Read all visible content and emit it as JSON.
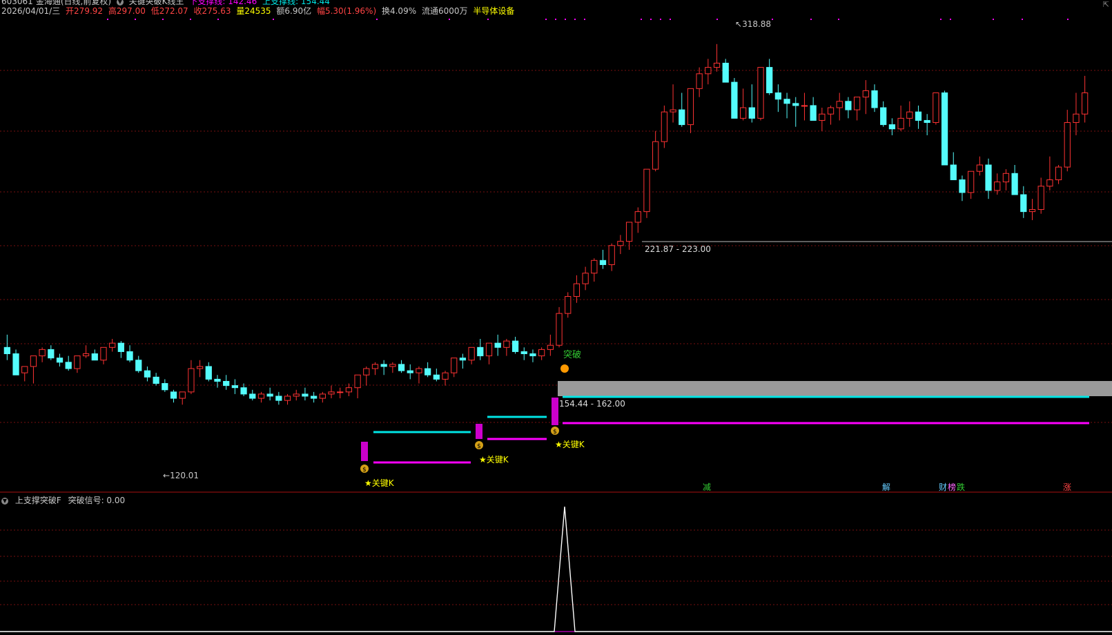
{
  "header": {
    "code": "603061",
    "name": "金海通",
    "period": "(日线,前复权)",
    "indicator_name": "关键突破K线王",
    "lower_support_label": "下支撑线: 142.46",
    "upper_support_label": "上支撑线: 154.44",
    "date": "2026/04/01/三",
    "open": "开279.92",
    "high": "高297.00",
    "low": "低272.07",
    "close": "收275.63",
    "volume": "量24535",
    "amount": "额6.90亿",
    "change": "幅5.30(1.96%)",
    "turnover": "换4.09%",
    "float": "流通6000万",
    "sector": "半导体设备"
  },
  "chart_annotations": {
    "peak_label": "318.88",
    "trough_label": "120.01",
    "upper_zone_label": "221.87 - 223.00",
    "lower_zone_label": "154.44 - 162.00",
    "breakout_label": "突破",
    "key_k_labels": [
      "★关键K",
      "★关键K",
      "★关键K"
    ]
  },
  "event_tags": [
    {
      "label": "减",
      "color": "#33cc33"
    },
    {
      "label": "解",
      "color": "#66ccff"
    },
    {
      "label": "财",
      "color": "#66ccff"
    },
    {
      "label": "榜",
      "color": "#ff66ff"
    },
    {
      "label": "跌",
      "color": "#33cc33"
    },
    {
      "label": "涨",
      "color": "#ff4444"
    }
  ],
  "subchart": {
    "title": "上支撑突破F",
    "signal_label": "突破信号: 0.00"
  },
  "colors": {
    "up": "#ff3333",
    "down": "#54fcfc",
    "grid": "#7a1010",
    "magenta": "#ff00ff",
    "cyan": "#00e5e5",
    "yellow": "#ffff00"
  },
  "chart_data": {
    "type": "candlestick",
    "y_range": [
      112,
      330
    ],
    "candles": [
      [
        176,
        182,
        170,
        173
      ],
      [
        173,
        175,
        163,
        163
      ],
      [
        164,
        166,
        160,
        167
      ],
      [
        167,
        169,
        159,
        172
      ],
      [
        172,
        176,
        169,
        175
      ],
      [
        175,
        177,
        170,
        171
      ],
      [
        171,
        173,
        167,
        169
      ],
      [
        169,
        172,
        165,
        166
      ],
      [
        166,
        170,
        164,
        172
      ],
      [
        172,
        177,
        171,
        173
      ],
      [
        173,
        175,
        170,
        170
      ],
      [
        170,
        175,
        168,
        176
      ],
      [
        176,
        180,
        174,
        178
      ],
      [
        178,
        179,
        171,
        174
      ],
      [
        174,
        177,
        169,
        170
      ],
      [
        170,
        172,
        164,
        165
      ],
      [
        165,
        167,
        160,
        162
      ],
      [
        162,
        164,
        158,
        159
      ],
      [
        159,
        161,
        155,
        156
      ],
      [
        155,
        156,
        150,
        152
      ],
      [
        152,
        154,
        149,
        155
      ],
      [
        155,
        170,
        154,
        166
      ],
      [
        166,
        170,
        162,
        167
      ],
      [
        167,
        169,
        160,
        161
      ],
      [
        161,
        163,
        157,
        160
      ],
      [
        160,
        163,
        156,
        158
      ],
      [
        158,
        161,
        154,
        157
      ],
      [
        157,
        159,
        153,
        154
      ],
      [
        154,
        156,
        151,
        152
      ],
      [
        152,
        155,
        150,
        154
      ],
      [
        154,
        157,
        151,
        153
      ],
      [
        153,
        155,
        149,
        151
      ],
      [
        151,
        154,
        149,
        153
      ],
      [
        153,
        156,
        151,
        154
      ],
      [
        154,
        157,
        151,
        153
      ],
      [
        153,
        155,
        150,
        152
      ],
      [
        152,
        155,
        150,
        154
      ],
      [
        154,
        158,
        152,
        155
      ],
      [
        155,
        157,
        152,
        155
      ],
      [
        155,
        159,
        153,
        157
      ],
      [
        157,
        160,
        152,
        163
      ],
      [
        163,
        167,
        158,
        166
      ],
      [
        166,
        169,
        163,
        168
      ],
      [
        168,
        170,
        163,
        167
      ],
      [
        167,
        169,
        164,
        168
      ],
      [
        168,
        170,
        164,
        165
      ],
      [
        165,
        168,
        161,
        164
      ],
      [
        164,
        167,
        159,
        166
      ],
      [
        166,
        169,
        162,
        163
      ],
      [
        163,
        166,
        160,
        161
      ],
      [
        161,
        165,
        158,
        164
      ],
      [
        164,
        168,
        162,
        171
      ],
      [
        171,
        173,
        166,
        170
      ],
      [
        170,
        176,
        168,
        176
      ],
      [
        176,
        180,
        170,
        172
      ],
      [
        172,
        178,
        168,
        178
      ],
      [
        178,
        182,
        172,
        176
      ],
      [
        176,
        180,
        172,
        179
      ],
      [
        179,
        181,
        173,
        174
      ],
      [
        174,
        176,
        170,
        173
      ],
      [
        173,
        175,
        169,
        172
      ],
      [
        172,
        176,
        170,
        175
      ],
      [
        175,
        182,
        172,
        177
      ],
      [
        177,
        195,
        176,
        192
      ],
      [
        192,
        202,
        190,
        200
      ],
      [
        200,
        210,
        197,
        206
      ],
      [
        206,
        214,
        203,
        211
      ],
      [
        211,
        218,
        207,
        217
      ],
      [
        217,
        222,
        213,
        215
      ],
      [
        215,
        225,
        212,
        224
      ],
      [
        224,
        229,
        220,
        226
      ],
      [
        226,
        234,
        222,
        235
      ],
      [
        235,
        242,
        230,
        240
      ],
      [
        240,
        256,
        237,
        260
      ],
      [
        260,
        278,
        259,
        273
      ],
      [
        273,
        290,
        270,
        287
      ],
      [
        287,
        300,
        282,
        288
      ],
      [
        288,
        296,
        280,
        281
      ],
      [
        281,
        293,
        277,
        298
      ],
      [
        298,
        308,
        294,
        305
      ],
      [
        305,
        312,
        300,
        308
      ],
      [
        308,
        319,
        306,
        310
      ],
      [
        310,
        312,
        305,
        301
      ],
      [
        301,
        303,
        285,
        284
      ],
      [
        284,
        298,
        283,
        289
      ],
      [
        289,
        300,
        282,
        284
      ],
      [
        284,
        301,
        283,
        308
      ],
      [
        308,
        312,
        295,
        296
      ],
      [
        296,
        300,
        287,
        293
      ],
      [
        293,
        296,
        284,
        291
      ],
      [
        291,
        294,
        280,
        290
      ],
      [
        290,
        296,
        283,
        290
      ],
      [
        290,
        294,
        284,
        283
      ],
      [
        283,
        289,
        278,
        286
      ],
      [
        286,
        290,
        281,
        289
      ],
      [
        289,
        296,
        283,
        292
      ],
      [
        292,
        294,
        284,
        288
      ],
      [
        288,
        294,
        283,
        294
      ],
      [
        294,
        302,
        286,
        297
      ],
      [
        297,
        300,
        287,
        289
      ],
      [
        289,
        292,
        280,
        281
      ],
      [
        281,
        284,
        276,
        279
      ],
      [
        279,
        290,
        278,
        284
      ],
      [
        284,
        292,
        280,
        287
      ],
      [
        287,
        290,
        279,
        283
      ],
      [
        283,
        286,
        276,
        282
      ],
      [
        282,
        292,
        281,
        296
      ],
      [
        296,
        297,
        262,
        262
      ],
      [
        262,
        268,
        255,
        255
      ],
      [
        255,
        257,
        245,
        249
      ],
      [
        249,
        257,
        246,
        259
      ],
      [
        259,
        266,
        257,
        262
      ],
      [
        262,
        265,
        246,
        250
      ],
      [
        250,
        258,
        248,
        254
      ],
      [
        254,
        260,
        250,
        258
      ],
      [
        258,
        262,
        250,
        248
      ],
      [
        248,
        252,
        237,
        240
      ],
      [
        240,
        246,
        236,
        241
      ],
      [
        241,
        256,
        239,
        252
      ],
      [
        252,
        266,
        250,
        255
      ],
      [
        255,
        262,
        253,
        261
      ],
      [
        261,
        288,
        259,
        282
      ],
      [
        282,
        296,
        276,
        286
      ],
      [
        286,
        304,
        282,
        296
      ]
    ],
    "lines": [
      {
        "name": "上支撑线",
        "value": 154.44,
        "color": "#00e5e5"
      },
      {
        "name": "下支撑线",
        "value": 142.46,
        "color": "#ff00ff"
      }
    ]
  }
}
